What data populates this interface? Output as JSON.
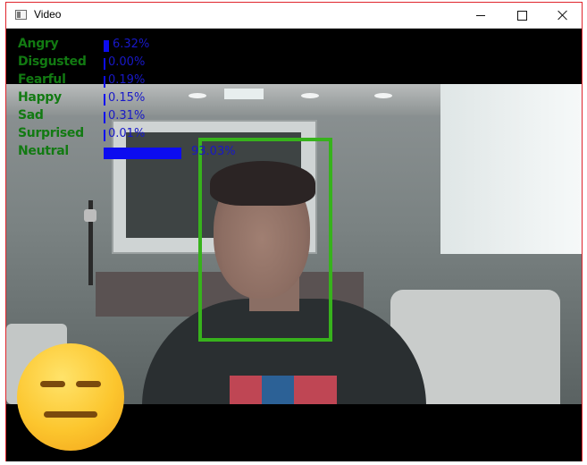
{
  "window": {
    "title": "Video"
  },
  "emotions": [
    {
      "label": "Angry",
      "percent_text": "6.32%",
      "value": 6.32
    },
    {
      "label": "Disgusted",
      "percent_text": "0.00%",
      "value": 0.0
    },
    {
      "label": "Fearful",
      "percent_text": "0.19%",
      "value": 0.19
    },
    {
      "label": "Happy",
      "percent_text": "0.15%",
      "value": 0.15
    },
    {
      "label": "Sad",
      "percent_text": "0.31%",
      "value": 0.31
    },
    {
      "label": "Surprised",
      "percent_text": "0.01%",
      "value": 0.01
    },
    {
      "label": "Neutral",
      "percent_text": "93.03%",
      "value": 93.03
    }
  ],
  "colors": {
    "label_green": "#127a12",
    "bar_blue": "#0c0cf0",
    "face_box_green": "#37b21c",
    "window_border": "#e0242c"
  },
  "icons": {
    "app": "window-app-icon",
    "emoji": "neutral-face-emoji"
  }
}
